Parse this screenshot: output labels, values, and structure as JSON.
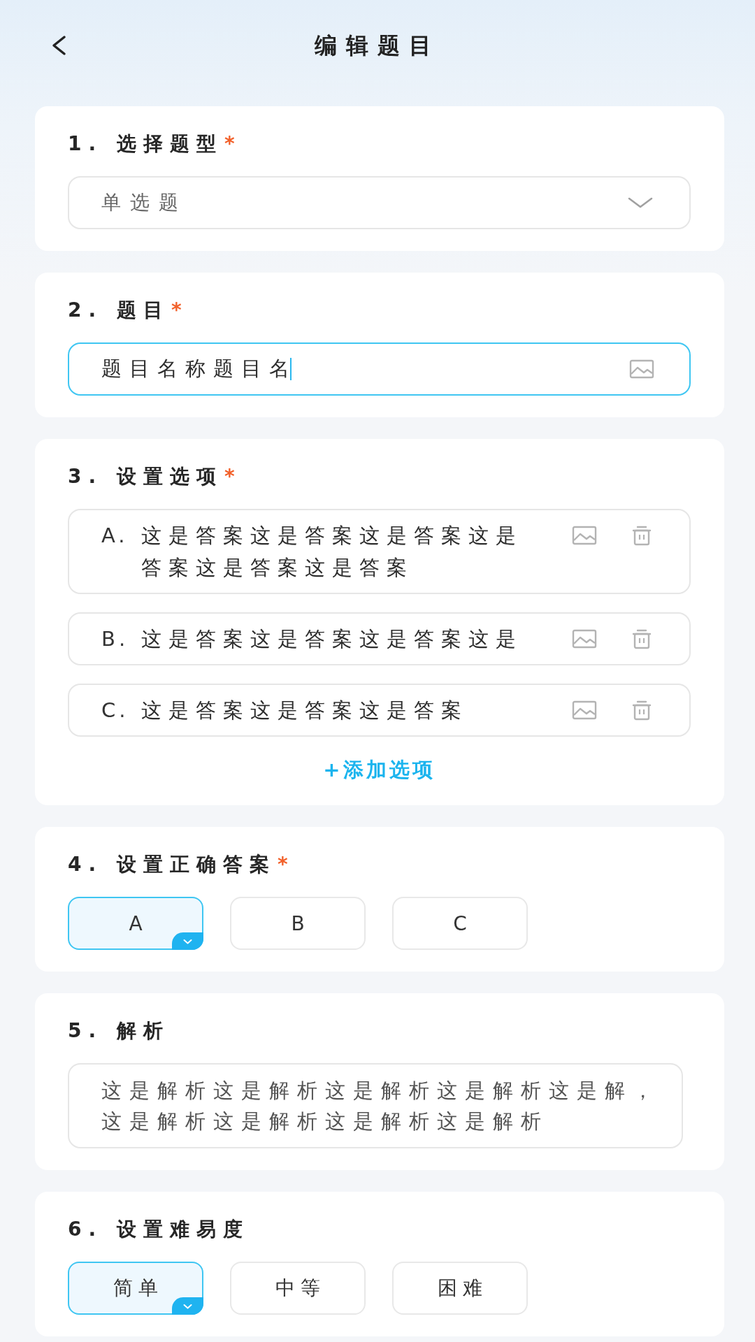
{
  "header": {
    "title": "编辑题目"
  },
  "sections": [
    {
      "kind": "dropdown",
      "label": "1. 选择题型",
      "required_mark": "*",
      "value": "单选题"
    },
    {
      "kind": "text_input",
      "label": "2. 题目",
      "required_mark": "*",
      "value": "题目名称题目名",
      "focused": true
    },
    {
      "kind": "options",
      "label": "3. 设置选项",
      "required_mark": "*",
      "options": [
        {
          "letter": "A.",
          "text": "这是答案这是答案这是答案这是答案这是答案这是答案"
        },
        {
          "letter": "B.",
          "text": "这是答案这是答案这是答案这是"
        },
        {
          "letter": "C.",
          "text": "这是答案这是答案这是答案"
        }
      ],
      "add_button": "+添加选项"
    },
    {
      "kind": "choice",
      "label": "4. 设置正确答案",
      "required_mark": "*",
      "choices": [
        {
          "label": "A",
          "selected": true
        },
        {
          "label": "B",
          "selected": false
        },
        {
          "label": "C",
          "selected": false
        }
      ]
    },
    {
      "kind": "textarea",
      "label": "5. 解析",
      "value": "这是解析这是解析这是解析这是解析这是解，这是解析这是解析这是解析这是解析"
    },
    {
      "kind": "choice",
      "label": "6. 设置难易度",
      "choices": [
        {
          "label": "简单",
          "selected": true
        },
        {
          "label": "中等",
          "selected": false
        },
        {
          "label": "困难",
          "selected": false
        }
      ]
    }
  ]
}
